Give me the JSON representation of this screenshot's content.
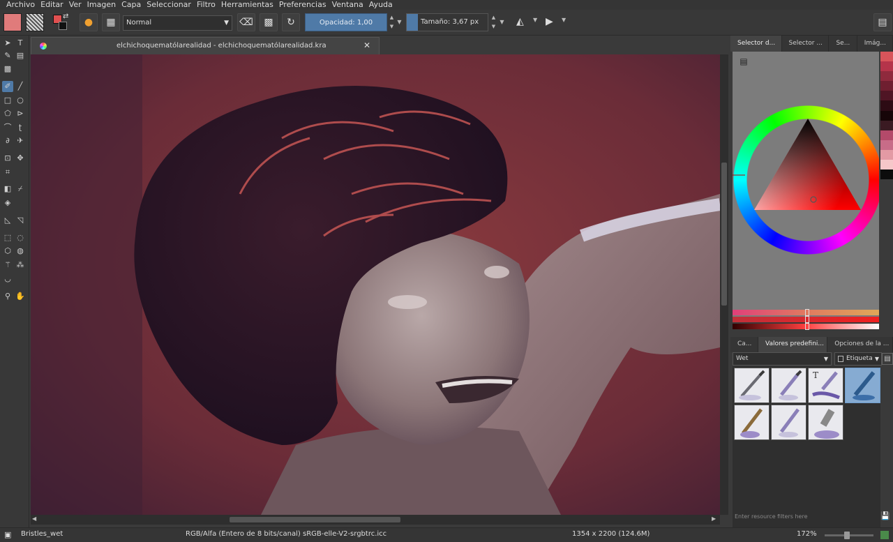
{
  "menu": [
    "Archivo",
    "Editar",
    "Ver",
    "Imagen",
    "Capa",
    "Seleccionar",
    "Filtro",
    "Herramientas",
    "Preferencias",
    "Ventana",
    "Ayuda"
  ],
  "toolbar": {
    "blend_mode": "Normal",
    "opacity_label": "Opacidad:  1,00",
    "size_label": "Tamaño:  3,67 px"
  },
  "document": {
    "tab_title": "elchichoquematólarealidad - elchichoquematólarealidad.kra"
  },
  "dock": {
    "tabs": [
      "Selector d...",
      "Selector ...",
      "Se...",
      "Imág..."
    ],
    "palette": [
      "#d8545a",
      "#b5344a",
      "#8f2a3d",
      "#6f1f30",
      "#4f1524",
      "#2d0b14",
      "#160508",
      "#3a1a22",
      "#b44a6a",
      "#c86c88",
      "#e39aa4",
      "#f6c7c9",
      "#0c0c0c"
    ],
    "preset_tabs": [
      "Ca...",
      "Valores predefini...",
      "Opciones de la ..."
    ],
    "tag_select": "Wet",
    "tag_label": "Etiqueta",
    "filter_placeholder": "Enter resource filters here"
  },
  "status": {
    "brush": "Bristles_wet",
    "colorspace": "RGB/Alfa (Entero de 8 bits/canal)  sRGB-elle-V2-srgbtrc.icc",
    "dimensions": "1354 x 2200 (124.6M)",
    "zoom": "172%"
  }
}
